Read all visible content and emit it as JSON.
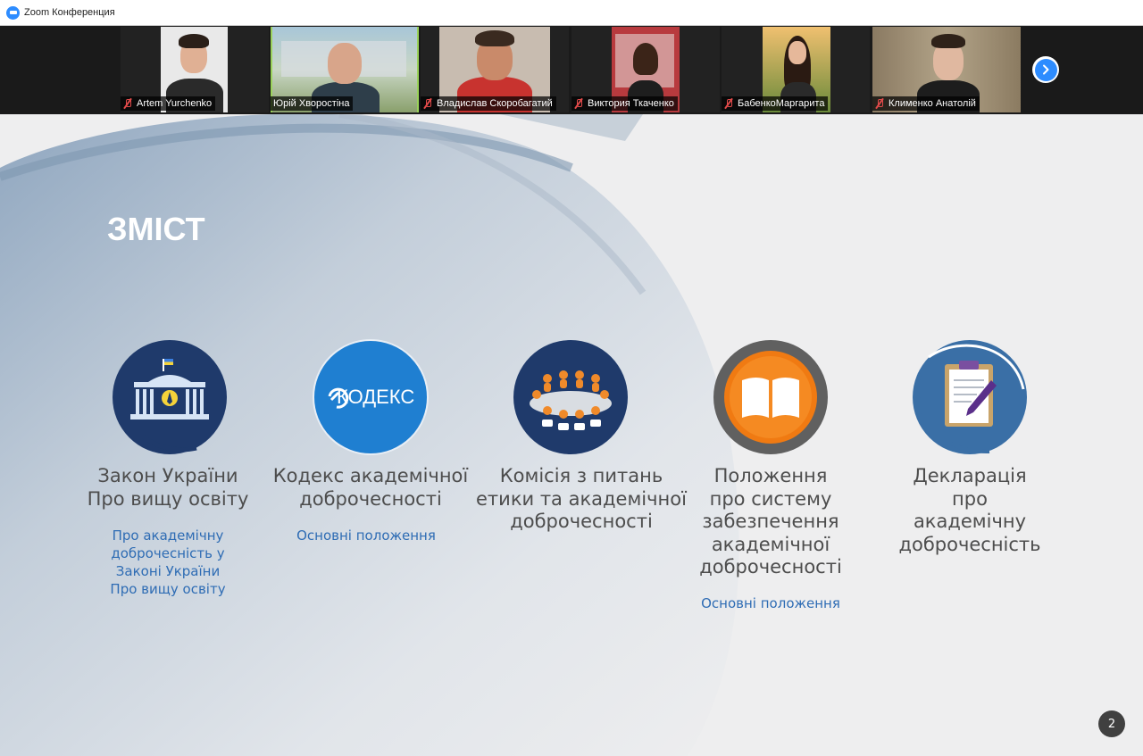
{
  "window": {
    "title": "Zoom Конференция"
  },
  "participants": [
    {
      "name": "Artem Yurchenko",
      "muted": true,
      "active": false
    },
    {
      "name": "Юрій Хворостіна",
      "muted": false,
      "active": true
    },
    {
      "name": "Владислав Скоробагатий",
      "muted": true,
      "active": false
    },
    {
      "name": "Виктория Ткаченко",
      "muted": true,
      "active": false
    },
    {
      "name": "БабенкоМаргарита",
      "muted": true,
      "active": false
    },
    {
      "name": "Клименко Анатолій",
      "muted": true,
      "active": false
    }
  ],
  "slide": {
    "title": "ЗМІСТ",
    "page_number": "2",
    "topics": [
      {
        "icon": "parliament-icon",
        "heading_lines": [
          "Закон України",
          "Про вищу освіту"
        ],
        "link_lines": [
          "Про академічну",
          "доброчесність у",
          "Законі України",
          "Про вищу освіту"
        ]
      },
      {
        "icon": "kodeks-logo-icon",
        "logo_text": "КОДЕКС",
        "heading_lines": [
          "Кодекс академічної",
          "доброчесності"
        ],
        "link_lines": [
          "Основні положення"
        ]
      },
      {
        "icon": "meeting-table-icon",
        "heading_lines": [
          "Комісія з питань",
          "етики та академічної",
          "доброчесності"
        ],
        "link_lines": []
      },
      {
        "icon": "open-book-icon",
        "heading_lines": [
          "Положення",
          "про систему",
          "забезпечення",
          "академічної",
          "доброчесності"
        ],
        "link_lines": [
          "Основні положення"
        ]
      },
      {
        "icon": "clipboard-pen-icon",
        "heading_lines": [
          "Декларація",
          "про",
          "академічну",
          "доброчесність"
        ],
        "link_lines": []
      }
    ]
  },
  "colors": {
    "zoom_blue": "#2d8cff",
    "slide_link": "#2e6cb4",
    "navy_circle": "#1f3a6b",
    "kodeks_blue": "#1f7fd1",
    "book_orange": "#f07a12",
    "clipboard_blue": "#3a6fa6"
  }
}
